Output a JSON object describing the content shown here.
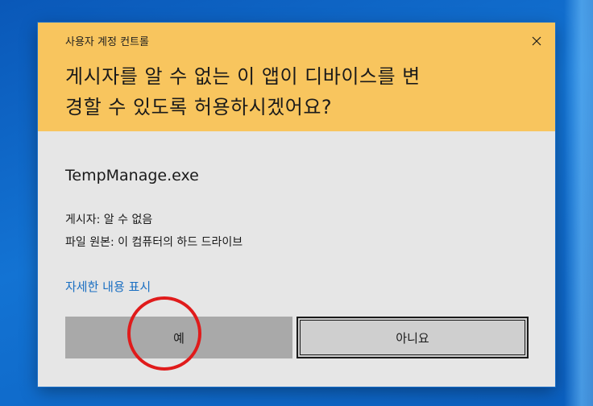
{
  "dialog": {
    "caption": "사용자 계정 컨트롤",
    "question": "게시자를 알 수 없는 이 앱이 디바이스를 변경할 수 있도록 허용하시겠어요?",
    "question_line1": "게시자를 알 수 없는 이 앱이 디바이스를 변",
    "question_line2": "경할 수 있도록 허용하시겠어요?",
    "app_name": "TempManage.exe",
    "publisher": "게시자: 알 수 없음",
    "origin": "파일 원본: 이 컴퓨터의 하드 드라이브",
    "details_link": "자세한 내용 표시",
    "yes_label": "예",
    "no_label": "아니요",
    "close_icon": "close-icon"
  },
  "colors": {
    "header": "#f8c55e",
    "body": "#e6e6e6",
    "link": "#1a6fc2",
    "highlight": "#e01b1b",
    "desktop": "#1373d3"
  }
}
